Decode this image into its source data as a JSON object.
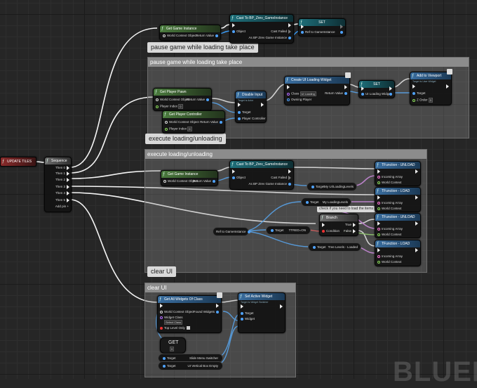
{
  "comments": {
    "pause": "pause game while loading take place",
    "execute": "execute loading/unloading",
    "clear": "clear UI"
  },
  "bubbles": {
    "pause": "pause game while loading take place",
    "execute": "execute loading/unloading",
    "clear": "clear UI",
    "branch_note": "check if you need to load the items"
  },
  "event": {
    "title": "UPDATE TILES"
  },
  "sequence": {
    "title": "Sequence",
    "then": [
      "Then 0",
      "Then 1",
      "Then 2",
      "Then 3",
      "Then 4",
      "Then 5"
    ],
    "add": "Add pin"
  },
  "top": {
    "get_gi": "Get Game Instance",
    "get_gi_pins": {
      "wco": "World Context Object",
      "ret": "Return Value"
    },
    "cast": "Cast To BP_Zrev_GameInstance",
    "cast_pins": {
      "obj": "Object",
      "fail": "Cast Failed",
      "as": "As BP Zrev Game Instance"
    },
    "set": "SET",
    "set_pins": {
      "ref": "Ref to GameInstance"
    }
  },
  "pause": {
    "get_player_pawn": "Get Player Pawn",
    "gpp_pins": {
      "wco": "World Context Object",
      "ret": "Return Value",
      "idx": "Player Index",
      "idx_val": "0"
    },
    "get_player_controller": "Get Player Controller",
    "gpc_pins": {
      "wco": "World Context Object",
      "ret": "Return Value",
      "idx": "Player Index",
      "idx_val": "0"
    },
    "disable_input": "Disable Input",
    "disable_sub": "Target is Actor",
    "di_pins": {
      "target": "Target",
      "pc": "Player Controller"
    },
    "create_widget": "Create UI Loading Widget",
    "cw_pins": {
      "class": "Class",
      "class_val": "UI Loading",
      "owning": "Owning Player",
      "ret": "Return Value"
    },
    "set": "SET",
    "set_pins": {
      "ui": "UI Loading Widget"
    },
    "add_viewport": "Add to Viewport",
    "add_sub": "Target is User Widget",
    "av_pins": {
      "target": "Target",
      "z": "Z Order",
      "z_val": "0"
    }
  },
  "execute": {
    "get_gi": "Get Game Instance",
    "get_gi_pins": {
      "wco": "World Context Object",
      "ret": "Return Value"
    },
    "cast": "Cast To BP_Zrev_GameInstance",
    "cast_pins": {
      "obj": "Object",
      "fail": "Cast Failed",
      "as": "As BP Zrev Game Instance"
    },
    "fn_unload_1": "TFunction - UNLOAD",
    "fn_load_1": "TFunction - LOAD",
    "fn_unload_2": "TFunction - UNLOAD",
    "fn_load_2": "TFunction - LOAD",
    "fn_pins": {
      "arr": "Incoming Array",
      "wc": "World Context"
    },
    "target_1": "Target",
    "var_1": "My UI/LoadingLevels",
    "target_2": "Target",
    "var_2": "My LoadingLevels",
    "ref": "Ref to GameInstance",
    "target_3": "Target",
    "var_3": "TTRED=ON",
    "branch": "Branch",
    "branch_pins": {
      "cond": "Condition",
      "t": "True",
      "f": "False"
    },
    "target_4": "Target",
    "var_4": "Tree Levels - Loaded"
  },
  "clear": {
    "get_all": "Get All Widgets Of Class",
    "ga_pins": {
      "wco": "World Context Object",
      "found": "Found Widgets",
      "class": "Widget Class",
      "class_val": "Select Class",
      "top": "Top Level Only"
    },
    "set_active": "Set Active Widget",
    "sa_sub": "Target is Widget Switcher",
    "sa_pins": {
      "target": "Target",
      "widget": "Widget"
    },
    "get": "GET",
    "get_val": "0",
    "target_1": "Target",
    "var_1": "Slide Menu Switcher",
    "target_2": "Target",
    "var_2": "UI Vertical Box Empty"
  },
  "watermark": "BLUEPR"
}
